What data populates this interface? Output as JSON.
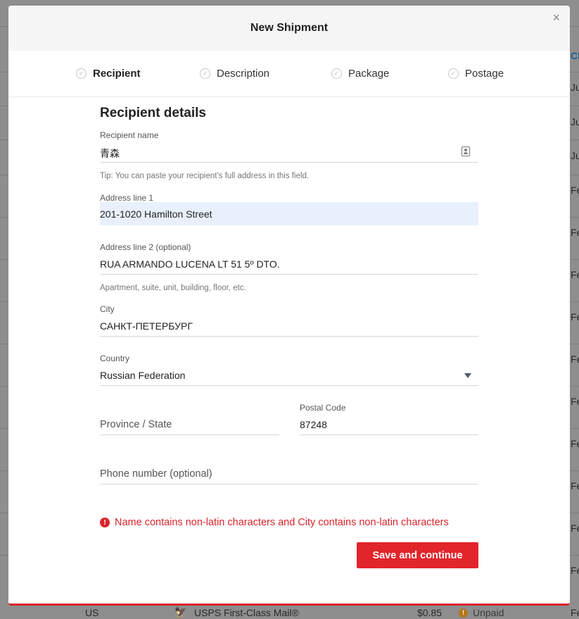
{
  "background": {
    "rows": [
      {
        "country": "US",
        "service": "USPS First-Class Mail®",
        "price": "$0.85",
        "status": "Unpaid"
      }
    ],
    "right_edge_texts": [
      "CRI",
      "Jur",
      "Jur",
      "Jur",
      "Feb",
      "Feb",
      "Feb",
      "Feb",
      "Feb",
      "Feb",
      "Feb",
      "Feb",
      "Feb",
      "Feb",
      "Feb"
    ]
  },
  "modal": {
    "title": "New Shipment",
    "close_label": "×",
    "steps": [
      {
        "label": "Recipient"
      },
      {
        "label": "Description"
      },
      {
        "label": "Package"
      },
      {
        "label": "Postage"
      }
    ],
    "section_title": "Recipient details",
    "fields": {
      "name": {
        "label": "Recipient name",
        "value": "青森",
        "hint": "Tip: You can paste your recipient's full address in this field."
      },
      "address1": {
        "label": "Address line 1",
        "value": "201-1020 Hamilton Street"
      },
      "address2": {
        "label": "Address line 2 (optional)",
        "value": "RUA ARMANDO LUCENA LT 51 5º DTO.",
        "hint": "Apartment, suite, unit, building, floor, etc."
      },
      "city": {
        "label": "City",
        "value": "САНКТ-ПЕТЕРБУРГ"
      },
      "country": {
        "label": "Country",
        "value": "Russian Federation"
      },
      "province": {
        "placeholder": "Province / State"
      },
      "postal": {
        "label": "Postal Code",
        "value": "87248"
      },
      "phone": {
        "placeholder": "Phone number (optional)"
      }
    },
    "error_message": "Name contains non-latin characters and City contains non-latin characters",
    "save_label": "Save and continue"
  },
  "colors": {
    "accent": "#e2242b",
    "autofill": "#e8f0fe"
  }
}
